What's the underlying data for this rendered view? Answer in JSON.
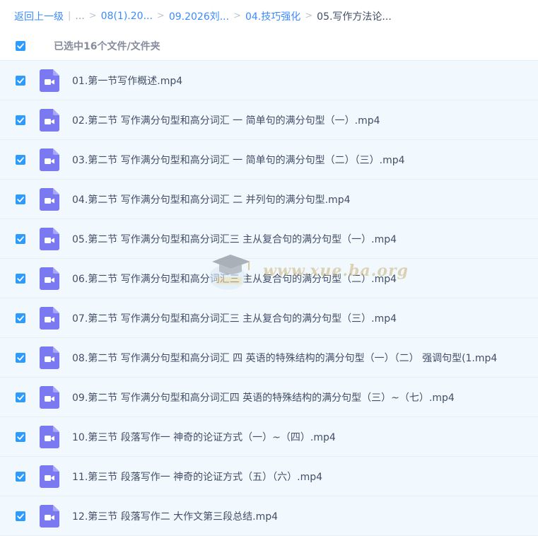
{
  "breadcrumb": {
    "back": "返回上一级",
    "sep_bar": "|",
    "ellipsis": "...",
    "crumbs": [
      "08(1).20...",
      "09.2026刘...",
      "04.技巧强化"
    ],
    "current": "05.写作方法论...",
    "sep": ">"
  },
  "selection": {
    "label": "已选中16个文件/文件夹"
  },
  "colors": {
    "accent": "#2f9bff",
    "icon": "#7b79f2",
    "row_bg": "#f2f9fe"
  },
  "files": [
    {
      "name": "01.第一节写作概述.mp4",
      "icon": "video-file-icon"
    },
    {
      "name": "02.第二节 写作满分句型和高分词汇 一 简单句的满分句型（一）.mp4",
      "icon": "video-file-icon"
    },
    {
      "name": "03.第二节 写作满分句型和高分词汇 一 简单句的满分句型（二）（三）.mp4",
      "icon": "video-file-icon"
    },
    {
      "name": "04.第二节 写作满分句型和高分词汇 二 并列句的满分句型.mp4",
      "icon": "video-file-icon"
    },
    {
      "name": "05.第二节 写作满分句型和高分词汇三 主从复合句的满分句型（一）.mp4",
      "icon": "video-file-icon"
    },
    {
      "name": "06.第二节 写作满分句型和高分词汇三 主从复合句的满分句型（二）.mp4",
      "icon": "video-file-icon"
    },
    {
      "name": "07.第二节 写作满分句型和高分词汇三 主从复合句的满分句型（三）.mp4",
      "icon": "video-file-icon"
    },
    {
      "name": "08.第二节 写作满分句型和高分词汇 四 英语的特殊结构的满分句型（一）（二） 强调句型(1.mp4",
      "icon": "video-file-icon"
    },
    {
      "name": "09.第二节 写作满分句型和高分词汇四 英语的特殊结构的满分句型（三）~（七）.mp4",
      "icon": "video-file-icon"
    },
    {
      "name": "10.第三节 段落写作一 神奇的论证方式（一）~（四）.mp4",
      "icon": "video-file-icon"
    },
    {
      "name": "11.第三节 段落写作一 神奇的论证方式（五）（六）.mp4",
      "icon": "video-file-icon"
    },
    {
      "name": "12.第三节 段落写作二 大作文第三段总结.mp4",
      "icon": "video-file-icon"
    }
  ],
  "watermark": {
    "text": "www.xue.ba.org"
  }
}
